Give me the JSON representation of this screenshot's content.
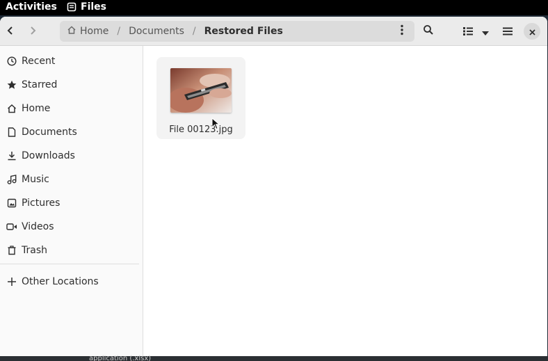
{
  "topbar": {
    "activities": "Activities",
    "app_name": "Files"
  },
  "pathbar": {
    "crumbs": [
      "Home",
      "Documents",
      "Restored Files"
    ],
    "separator": "/"
  },
  "sidebar": {
    "items": [
      {
        "label": "Recent",
        "icon": "clock-icon"
      },
      {
        "label": "Starred",
        "icon": "star-icon"
      },
      {
        "label": "Home",
        "icon": "home-icon"
      },
      {
        "label": "Documents",
        "icon": "document-icon"
      },
      {
        "label": "Downloads",
        "icon": "download-icon"
      },
      {
        "label": "Music",
        "icon": "music-icon"
      },
      {
        "label": "Pictures",
        "icon": "picture-icon"
      },
      {
        "label": "Videos",
        "icon": "video-icon"
      },
      {
        "label": "Trash",
        "icon": "trash-icon"
      }
    ],
    "other_locations": "Other Locations"
  },
  "files": [
    {
      "name": "File 00123.jpg"
    }
  ],
  "desktop_fragment": "application (.xlsx)",
  "colors": {
    "topbar": "#000000",
    "headerbar": "#ebebeb",
    "pathbar": "#dcdcdc",
    "sidebar": "#fafafa",
    "text": "#2e2e2e"
  }
}
